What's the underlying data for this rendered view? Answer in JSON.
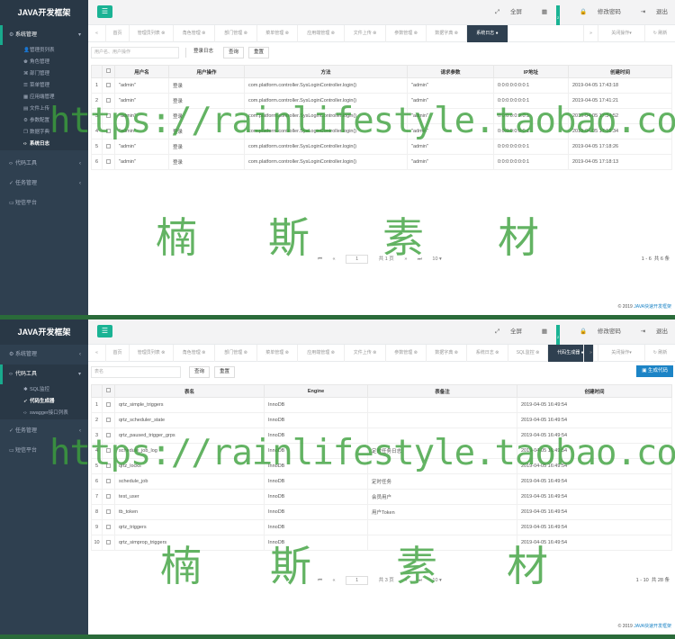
{
  "app_title": "JAVA开发框架",
  "topbar": {
    "fullscreen": "全屏",
    "badge": "2",
    "change_password": "修改密码",
    "logout": "退出"
  },
  "tab_close_ops": "关闭操作",
  "tab_refresh": "刷新",
  "panel1": {
    "menu": {
      "system": "系统管理",
      "system_items": [
        "管理员列表",
        "角色管理",
        "部门管理",
        "菜单管理",
        "应用端管理",
        "文件上传",
        "参数配置",
        "数据字典",
        "系统日志"
      ],
      "code_tools": "代码工具",
      "task": "任务管理",
      "platform": "短信平台"
    },
    "tabs": [
      "首页",
      "管理员列表",
      "角色管理",
      "部门管理",
      "菜单管理",
      "应用端管理",
      "文件上传",
      "参数管理",
      "数据字典",
      "系统日志"
    ],
    "search_placeholder": "用户名、用户操作",
    "login_log_label": "登录日志",
    "query_button": "查询",
    "reset_button": "重置",
    "columns": [
      "",
      "",
      "用户名",
      "用户操作",
      "方法",
      "请求参数",
      "IP地址",
      "创建时间"
    ],
    "rows": [
      [
        "1",
        "\"admin\"",
        "登录",
        "com.platform.controller.SysLoginController.login()",
        "\"admin\"",
        "0:0:0:0:0:0:0:1",
        "2019-04-05 17:43:18"
      ],
      [
        "2",
        "\"admin\"",
        "登录",
        "com.platform.controller.SysLoginController.login()",
        "\"admin\"",
        "0:0:0:0:0:0:0:1",
        "2019-04-05 17:41:21"
      ],
      [
        "3",
        "\"admin\"",
        "登录",
        "com.platform.controller.SysLoginController.login()",
        "\"admin\"",
        "0:0:0:0:0:0:0:1",
        "2019-04-05 17:34:52"
      ],
      [
        "4",
        "\"admin\"",
        "登录",
        "com.platform.controller.SysLoginController.login()",
        "\"admin\"",
        "0:0:0:0:0:0:0:1",
        "2019-04-05 17:18:34"
      ],
      [
        "5",
        "\"admin\"",
        "登录",
        "com.platform.controller.SysLoginController.login()",
        "\"admin\"",
        "0:0:0:0:0:0:0:1",
        "2019-04-05 17:18:26"
      ],
      [
        "6",
        "\"admin\"",
        "登录",
        "com.platform.controller.SysLoginController.login()",
        "\"admin\"",
        "0:0:0:0:0:0:0:1",
        "2019-04-05 17:18:13"
      ]
    ],
    "pager": {
      "page": "1",
      "total_pages": "共 1 页",
      "page_size": "10 ▾",
      "range": "1 - 6",
      "total": "共 6 条"
    }
  },
  "panel2": {
    "menu": {
      "system": "系统管理",
      "code_tools": "代码工具",
      "code_items": [
        "SQL监控",
        "代码生成器",
        "swagger接口列表"
      ],
      "task": "任务管理",
      "platform": "短信平台"
    },
    "tabs": [
      "首页",
      "管理员列表",
      "角色管理",
      "部门管理",
      "菜单管理",
      "应用端管理",
      "文件上传",
      "参数管理",
      "数据字典",
      "系统日志",
      "SQL监控",
      "代码生成器"
    ],
    "search_placeholder": "表名",
    "query_button": "查询",
    "reset_button": "重置",
    "generate_button": "生成代码",
    "columns": [
      "",
      "",
      "表名",
      "Engine",
      "表备注",
      "创建时间"
    ],
    "rows": [
      [
        "1",
        "qrtz_simple_triggers",
        "InnoDB",
        "",
        "2019-04-05 16:49:54"
      ],
      [
        "2",
        "qrtz_scheduler_state",
        "InnoDB",
        "",
        "2019-04-05 16:49:54"
      ],
      [
        "3",
        "qrtz_paused_trigger_grps",
        "InnoDB",
        "",
        "2019-04-05 16:49:54"
      ],
      [
        "4",
        "schedule_job_log",
        "InnoDB",
        "定时任务日志",
        "2019-04-05 16:49:54"
      ],
      [
        "5",
        "qrtz_locks",
        "InnoDB",
        "",
        "2019-04-05 16:49:54"
      ],
      [
        "6",
        "schedule_job",
        "InnoDB",
        "定时任务",
        "2019-04-05 16:49:54"
      ],
      [
        "7",
        "test_user",
        "InnoDB",
        "会员用户",
        "2019-04-05 16:49:54"
      ],
      [
        "8",
        "tb_token",
        "InnoDB",
        "用户Token",
        "2019-04-05 16:49:54"
      ],
      [
        "9",
        "qrtz_triggers",
        "InnoDB",
        "",
        "2019-04-05 16:49:54"
      ],
      [
        "10",
        "qrtz_simprop_triggers",
        "InnoDB",
        "",
        "2019-04-05 16:49:54"
      ]
    ],
    "pager": {
      "page": "1",
      "total_pages": "共 3 页",
      "page_size": "10 ▾",
      "range": "1 - 10",
      "total": "共 28 条"
    }
  },
  "footer_copyright": "© 2019",
  "footer_link": "JAVA快速开发框架",
  "watermark_url": "https://rainlifestyle.taobao.com",
  "watermark_chars": [
    "楠",
    "斯",
    "素",
    "材"
  ],
  "accent_color": "#1ab394"
}
